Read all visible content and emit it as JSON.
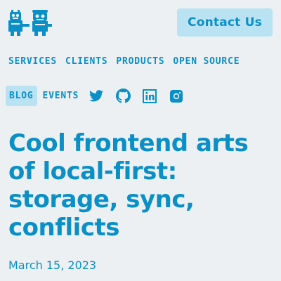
{
  "header": {
    "logo_icon": "robot-mascots-logo",
    "contact_label": "Contact Us"
  },
  "nav": {
    "primary": [
      "SERVICES",
      "CLIENTS",
      "PRODUCTS",
      "OPEN SOURCE"
    ],
    "blog_label": "BLOG",
    "events_label": "EVENTS",
    "social_icons": [
      "twitter-icon",
      "github-icon",
      "linkedin-icon",
      "instagram-icon"
    ]
  },
  "article": {
    "title": "Cool frontend arts of local-first: storage, sync, conflicts",
    "date": "March 15, 2023"
  },
  "colors": {
    "accent": "#0a8fc6",
    "accent_light": "#b9e3f2",
    "background": "#edf0f2"
  }
}
